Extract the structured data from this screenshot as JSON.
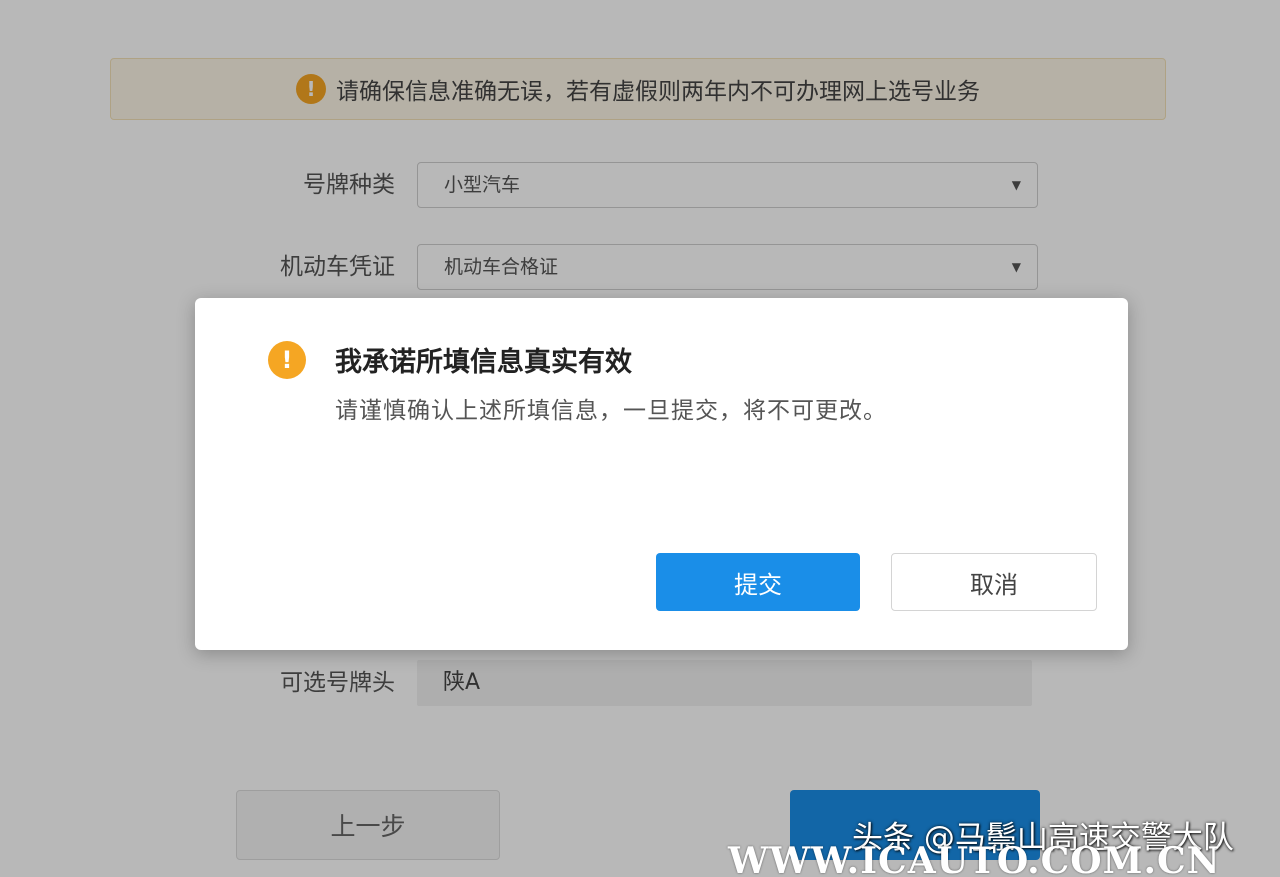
{
  "notice": {
    "icon": "exclamation-circle-icon",
    "text": "请确保信息准确无误，若有虚假则两年内不可办理网上选号业务"
  },
  "form": {
    "plate_type": {
      "label": "号牌种类",
      "value": "小型汽车"
    },
    "vehicle_cert": {
      "label": "机动车凭证",
      "value": "机动车合格证"
    },
    "plate_prefix": {
      "label": "可选号牌头",
      "value": "陕A"
    }
  },
  "buttons": {
    "prev": "上一步"
  },
  "dialog": {
    "icon": "exclamation-circle-icon",
    "title": "我承诺所填信息真实有效",
    "body": "请谨慎确认上述所填信息，一旦提交，将不可更改。",
    "submit": "提交",
    "cancel": "取消"
  },
  "watermark": {
    "line1": "头条 @马鬃山高速交警大队",
    "line2": "WWW.ICAUTO.COM.CN"
  },
  "colors": {
    "primary": "#1a8ee8",
    "warning": "#f5a623",
    "notice_bg": "#fdf6e6"
  }
}
